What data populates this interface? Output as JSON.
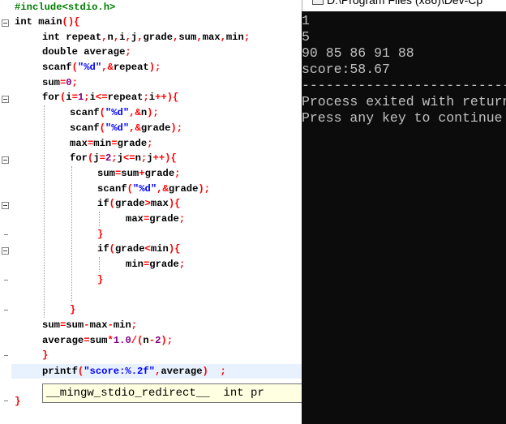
{
  "editor": {
    "lines": {
      "l1": "#include<stdio.h>",
      "l2a": "int",
      "l2b": " main",
      "l2c": "(){",
      "l3a": "int",
      "l3b": " repeat",
      "l3c": ",",
      "l3d": "n",
      "l3e": ",",
      "l3f": "i",
      "l3g": ",",
      "l3h": "j",
      "l3i": ",",
      "l3j": "grade",
      "l3k": ",",
      "l3l": "sum",
      "l3m": ",",
      "l3n": "max",
      "l3o": ",",
      "l3p": "min",
      "l3q": ";",
      "l4a": "double",
      "l4b": " average",
      "l4c": ";",
      "l5a": "scanf",
      "l5b": "(",
      "l5c": "\"%d\"",
      "l5d": ",&",
      "l5e": "repeat",
      "l5f": ");",
      "l6a": "sum",
      "l6b": "=",
      "l6c": "0",
      "l6d": ";",
      "l7a": "for",
      "l7b": "(",
      "l7c": "i",
      "l7d": "=",
      "l7e": "1",
      "l7f": ";",
      "l7g": "i",
      "l7h": "<=",
      "l7i": "repeat",
      "l7j": ";",
      "l7k": "i",
      "l7l": "++){",
      "l8a": "scanf",
      "l8b": "(",
      "l8c": "\"%d\"",
      "l8d": ",&",
      "l8e": "n",
      "l8f": ");",
      "l9a": "scanf",
      "l9b": "(",
      "l9c": "\"%d\"",
      "l9d": ",&",
      "l9e": "grade",
      "l9f": ");",
      "l10a": "max",
      "l10b": "=",
      "l10c": "min",
      "l10d": "=",
      "l10e": "grade",
      "l10f": ";",
      "l11a": "for",
      "l11b": "(",
      "l11c": "j",
      "l11d": "=",
      "l11e": "2",
      "l11f": ";",
      "l11g": "j",
      "l11h": "<=",
      "l11i": "n",
      "l11j": ";",
      "l11k": "j",
      "l11l": "++){",
      "l12a": "sum",
      "l12b": "=",
      "l12c": "sum",
      "l12d": "+",
      "l12e": "grade",
      "l12f": ";",
      "l13a": "scanf",
      "l13b": "(",
      "l13c": "\"%d\"",
      "l13d": ",&",
      "l13e": "grade",
      "l13f": ");",
      "l14a": "if",
      "l14b": "(",
      "l14c": "grade",
      "l14d": ">",
      "l14e": "max",
      "l14f": "){",
      "l15a": "max",
      "l15b": "=",
      "l15c": "grade",
      "l15d": ";",
      "l16": "}",
      "l17a": "if",
      "l17b": "(",
      "l17c": "grade",
      "l17d": "<",
      "l17e": "min",
      "l17f": "){",
      "l18a": "min",
      "l18b": "=",
      "l18c": "grade",
      "l18d": ";",
      "l19": "}",
      "l20": "}",
      "l21a": "sum",
      "l21b": "=",
      "l21c": "sum",
      "l21d": "-",
      "l21e": "max",
      "l21f": "-",
      "l21g": "min",
      "l21h": ";",
      "l22a": "average",
      "l22b": "=",
      "l22c": "sum",
      "l22d": "*",
      "l22e": "1.0",
      "l22f": "/(",
      "l22g": "n",
      "l22h": "-",
      "l22i": "2",
      "l22j": ");",
      "l23": "}",
      "l24a": "printf",
      "l24b": "(",
      "l24c": "\"score:%.2f\"",
      "l24d": ",",
      "l24e": "average",
      "l24f": ")  ;",
      "l25": "}"
    },
    "tooltip": "__mingw_stdio_redirect__  int pr"
  },
  "console": {
    "title": "D:\\Program Files (x86)\\Dev-Cp",
    "lines": [
      "1",
      "5",
      "90 85 86 91 88",
      "score:58.67",
      "--------------------------------",
      "Process exited with return",
      "Press any key to continue"
    ]
  },
  "colors": {
    "preprocessor": "#008000",
    "keyword": "#000000",
    "symbol": "#ff0000",
    "number": "#800080",
    "string": "#0000ff",
    "console_bg": "#0c0c0c",
    "console_text": "#c0c0c0",
    "current_line": "#e8f2fe",
    "tooltip_bg": "#ffffe1"
  },
  "icons": {
    "fold": "fold-minus-icon",
    "console_window": "console-window-icon"
  }
}
